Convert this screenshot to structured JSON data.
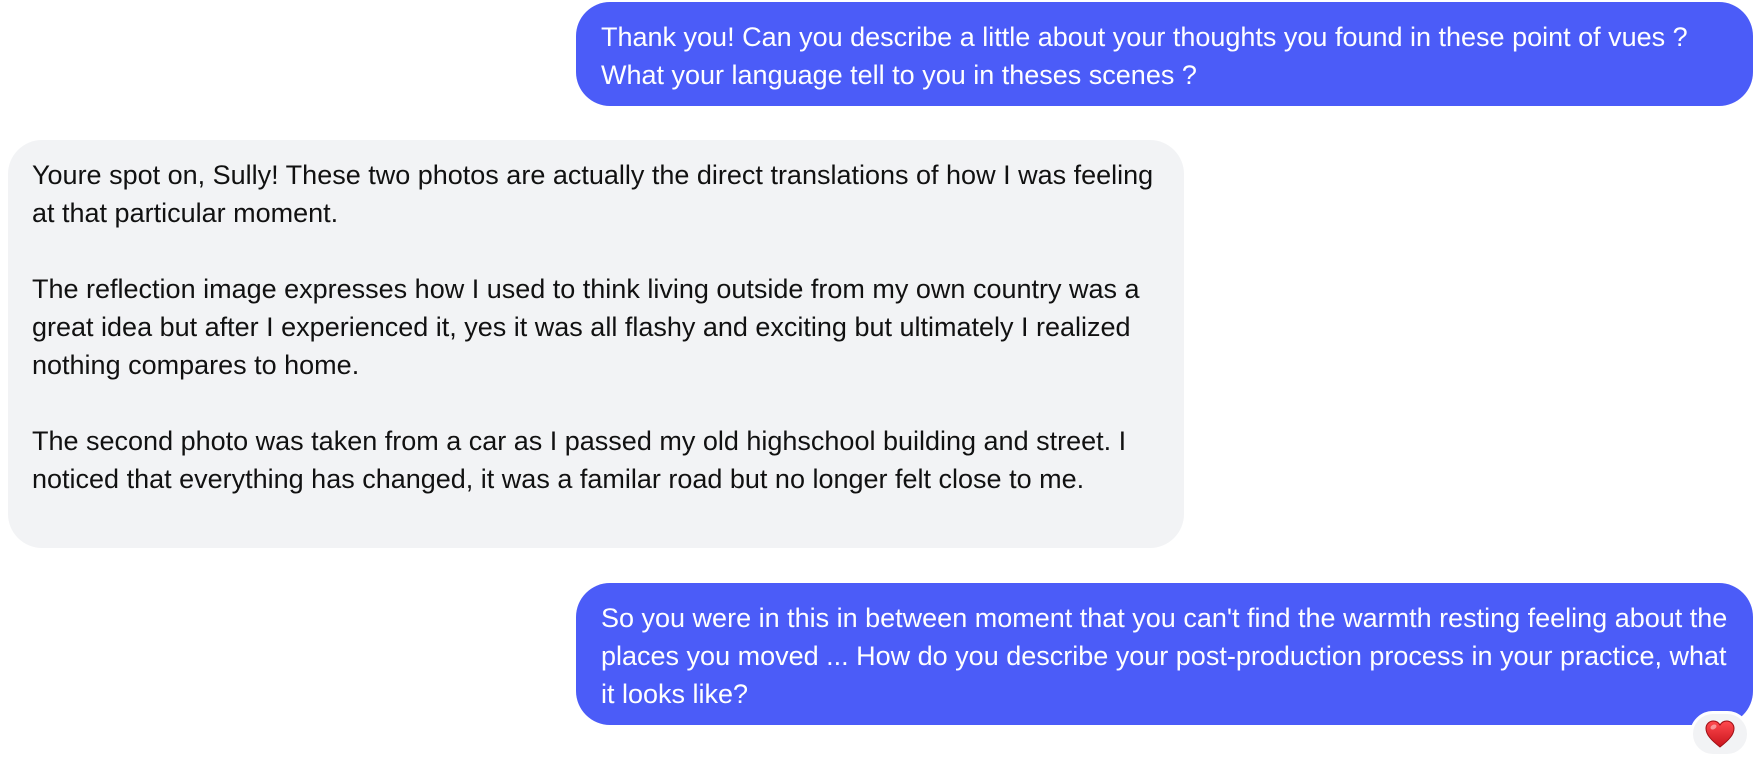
{
  "messages": [
    {
      "id": "msg1",
      "direction": "outgoing",
      "text": "Thank you! Can you describe a little about your thoughts you found in these point of vues ? What your language tell to you in theses scenes ?"
    },
    {
      "id": "msg2",
      "direction": "incoming",
      "text": "Youre spot on, Sully! These two photos are actually the direct translations of how I was feeling at that particular moment.\n\nThe reflection image expresses how I used to think living outside from my own country was a great idea but after I experienced it, yes it was all flashy and exciting but ultimately I realized nothing compares to home.\n\nThe second photo was taken from a car as I passed my old highschool building and street. I noticed that everything has changed, it was a familar road but no longer felt close to me."
    },
    {
      "id": "msg3",
      "direction": "outgoing",
      "text": "So you were in this in between moment that you can't find the warmth resting feeling about the places you moved ... How do you describe your post-production process in your practice, what it looks like?",
      "reaction": "red-heart-icon"
    }
  ],
  "colors": {
    "outgoing_bubble": "#4b5cf8",
    "incoming_bubble": "#f2f3f5",
    "outgoing_text": "#ffffff",
    "incoming_text": "#111111",
    "heart": "#e0242b"
  }
}
